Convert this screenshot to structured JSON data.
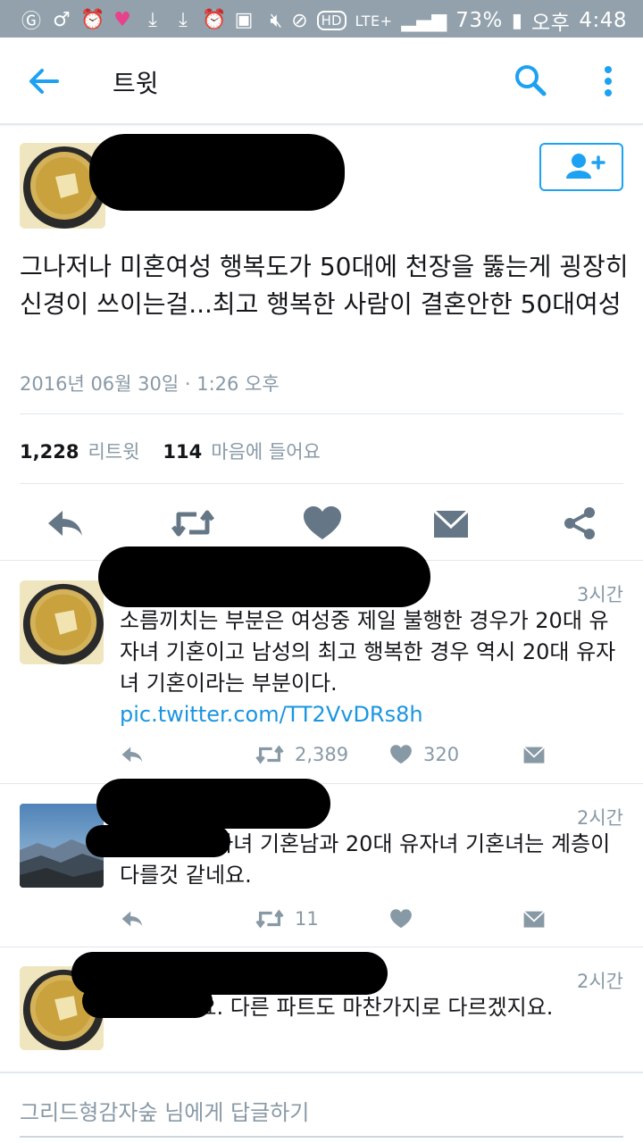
{
  "status_bar": {
    "battery_percent": "73%",
    "ampm": "오후",
    "clock": "4:48",
    "network": "LTE+"
  },
  "app_bar": {
    "title": "트윗"
  },
  "main_tweet": {
    "text": "그나저나 미혼여성 행복도가 50대에 천장을 뚫는게 굉장히 신경이 쓰이는걸...최고 행복한 사람이 결혼안한 50대여성",
    "timestamp": "2016년 06월 30일 · 1:26 오후",
    "retweet_count": "1,228",
    "retweet_label": "리트윗",
    "like_count": "114",
    "like_label": "마음에 들어요"
  },
  "replies": [
    {
      "time": "3시간",
      "text": "소름끼치는 부분은 여성중 제일 불행한 경우가 20대 유자녀 기혼이고 남성의 최고 행복한 경우 역시 20대 유자녀 기혼이라는 부분이다. ",
      "link": "pic.twitter.com/TT2VvDRs8h",
      "retweets": "2,389",
      "likes": "320"
    },
    {
      "time": "2시간",
      "mention_tail": "n",
      "text": " 20대 유자녀 기혼남과 20대 유자녀 기혼녀는 계층이 다를것 같네요.",
      "retweets": "11"
    },
    {
      "time": "2시간",
      "mention_tail": "s",
      "text": " 그러네요. 다른 파트도 마찬가지로 다르겠지요."
    }
  ],
  "reply_bar": {
    "placeholder": "그리드형감자숲 님에게 답글하기"
  },
  "colors": {
    "accent": "#1da1f2",
    "status_bar": "#92a1ac",
    "muted": "#8899a6",
    "icon": "#657786"
  }
}
